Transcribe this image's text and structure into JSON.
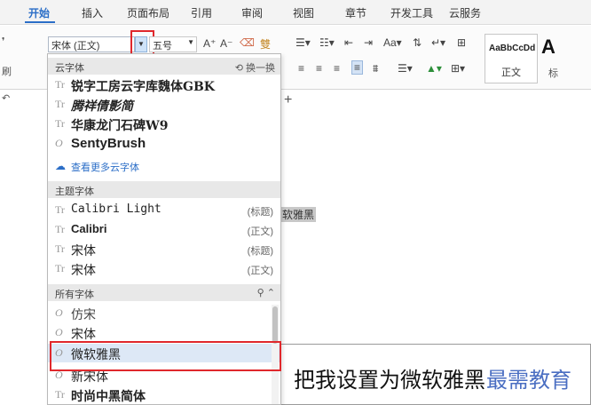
{
  "tabs": [
    "开始",
    "插入",
    "页面布局",
    "引用",
    "审阅",
    "视图",
    "章节",
    "开发工具",
    "云服务"
  ],
  "ribbon": {
    "font_name": "宋体 (正文)",
    "font_size": "五号",
    "grow_font": "A⁺",
    "shrink_font": "A⁻",
    "style_sample": "AaBbCcDd",
    "style_label": "正文",
    "style_big": "A",
    "style_side": "标",
    "left_glyph_1": "刷",
    "left_glyph_2": "↶"
  },
  "dropdown": {
    "cloud_section": "云字体",
    "switch_label": "换一换",
    "cloud_fonts": [
      {
        "icon": "Tr",
        "name": "锐字工房云字库魏体GBK"
      },
      {
        "icon": "Tr",
        "name": "腾祥倩影简"
      },
      {
        "icon": "Tr",
        "name": "华康龙门石碑W9"
      },
      {
        "icon": "O",
        "name": "SentyBrush"
      }
    ],
    "more_cloud": "查看更多云字体",
    "theme_section": "主题字体",
    "theme_fonts": [
      {
        "icon": "Tr",
        "name": "Calibri Light",
        "tag": "(标题)"
      },
      {
        "icon": "Tr",
        "name": "Calibri",
        "tag": "(正文)"
      },
      {
        "icon": "Tr",
        "name": "宋体",
        "tag": "(标题)"
      },
      {
        "icon": "Tr",
        "name": "宋体",
        "tag": "(正文)"
      }
    ],
    "all_section": "所有字体",
    "all_fonts": [
      {
        "icon": "O",
        "name": "仿宋"
      },
      {
        "icon": "O",
        "name": "宋体"
      },
      {
        "icon": "O",
        "name": "微软雅黑"
      },
      {
        "icon": "O",
        "name": "新宋体"
      },
      {
        "icon": "Tr",
        "name": "时尚中黑简体"
      }
    ]
  },
  "document": {
    "selected_text": "软雅黑",
    "callout_text": "把我设置为微软雅黑",
    "watermark": "最需教育"
  }
}
